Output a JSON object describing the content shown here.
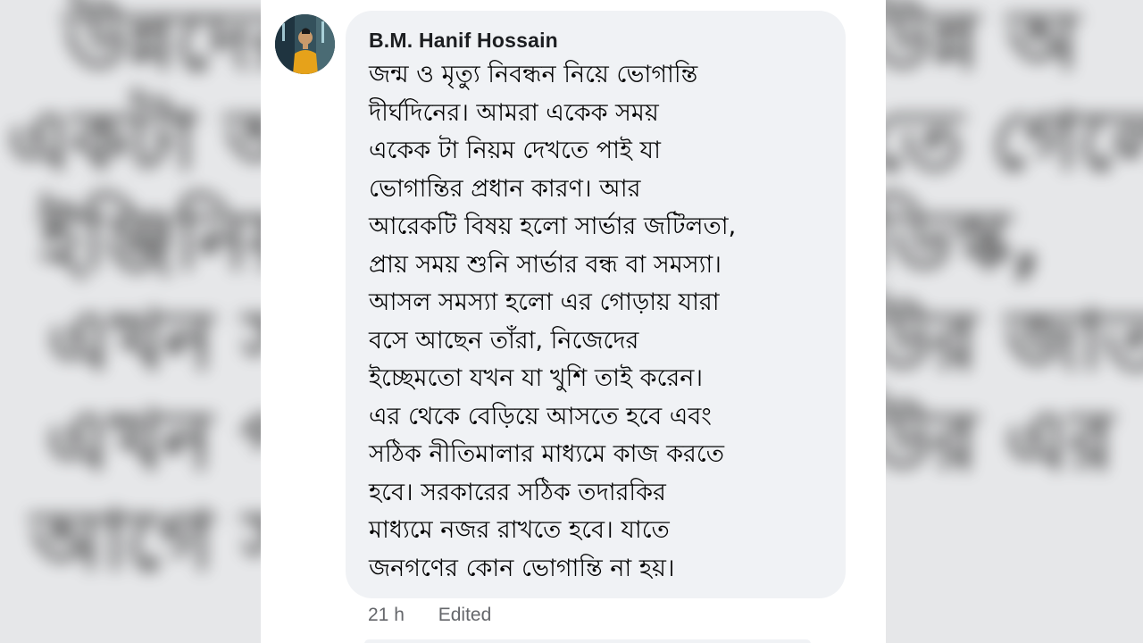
{
  "background": {
    "left_blur_lines": [
      "উন্নদের",
      "একটা অ",
      "ইঞ্জিনিয়",
      "এখন স",
      "এখন প",
      "আগে স"
    ],
    "right_blur_lines": [
      "উন্ন অ",
      "তে গেলে",
      "ডিস্ক,",
      "উর জাত",
      "উর এর"
    ]
  },
  "comment": {
    "author": "B.M. Hanif Hossain",
    "avatar_icon": "profile-photo",
    "lines": [
      "জন্ম ও মৃত্যু নিবন্ধন নিয়ে ভোগান্তি",
      "দীর্ঘদিনের। আমরা একেক সময়",
      "একেক টা নিয়ম দেখতে পাই যা",
      "ভোগান্তির প্রধান কারণ। আর",
      "আরেকটি বিষয় হলো সার্ভার জটিলতা,",
      "প্রায় সময় শুনি সার্ভার বন্ধ বা সমস্যা।",
      "আসল সমস্যা হলো এর গোড়ায় যারা",
      "বসে আছেন তাঁরা, নিজেদের",
      "ইচ্ছেমতো যখন যা খুশি তাই করেন।",
      "এর থেকে বেড়িয়ে আসতে হবে এবং",
      "সঠিক নীতিমালার মাধ্যমে কাজ করতে",
      "হবে। সরকারের সঠিক তদারকির",
      "মাধ্যমে নজর রাখতে হবে। যাতে",
      "জনগণের কোন ভোগান্তি না হয়।"
    ],
    "time": "21 h",
    "edited_label": "Edited"
  },
  "colors": {
    "bubble": "#f0f2f5",
    "meta_text": "#65676b",
    "text": "#050505"
  }
}
